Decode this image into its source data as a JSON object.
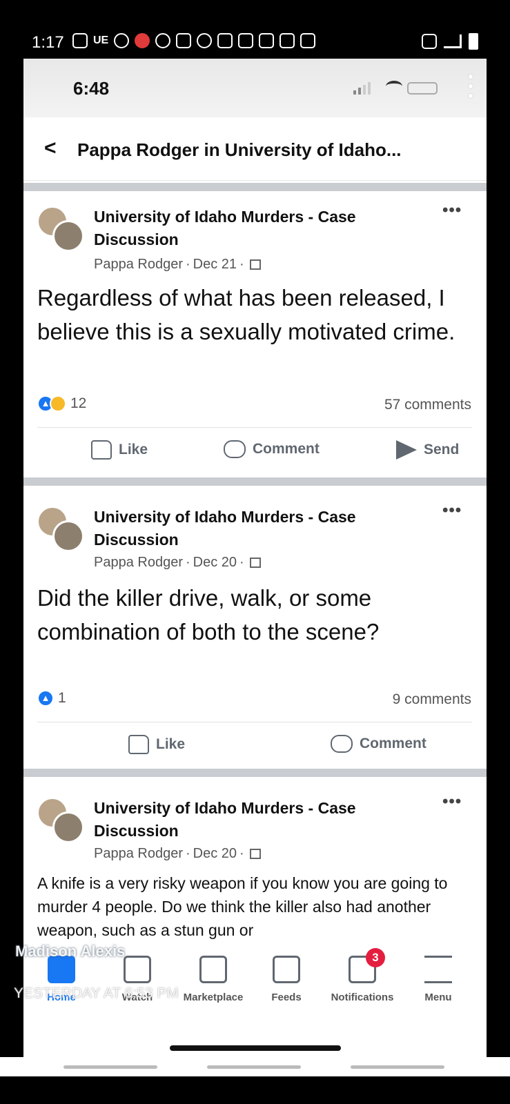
{
  "outer_status": {
    "time": "1:17",
    "carrier": "UE"
  },
  "inner_status": {
    "time": "6:48"
  },
  "header": {
    "title": "Pappa Rodger in University of Idaho..."
  },
  "posts": [
    {
      "group": "University of Idaho Murders - Case Discussion",
      "author": "Pappa Rodger",
      "date": "Dec 21",
      "body": "Regardless of what has been released, I believe this is a sexually motivated crime.",
      "reactions": "12",
      "comments": "57 comments",
      "actions": {
        "like": "Like",
        "comment": "Comment",
        "send": "Send"
      }
    },
    {
      "group": "University of Idaho Murders - Case Discussion",
      "author": "Pappa Rodger",
      "date": "Dec 20",
      "body": "Did the killer drive, walk, or some combination of both to the scene?",
      "reactions": "1",
      "comments": "9 comments",
      "actions": {
        "like": "Like",
        "comment": "Comment"
      }
    },
    {
      "group": "University of Idaho Murders - Case Discussion",
      "author": "Pappa Rodger",
      "date": "Dec 20",
      "body": "A knife is a very risky weapon if you know you are going to murder 4 people.  Do we think the killer also had another weapon, such as a stun gun or"
    }
  ],
  "tabbar": {
    "home": "Home",
    "watch": "Watch",
    "marketplace": "Marketplace",
    "feeds": "Feeds",
    "notifications": "Notifications",
    "notifications_badge": "3",
    "menu": "Menu"
  },
  "overlay": {
    "name": "Madison Alexis",
    "timestamp": "YESTERDAY AT 6:53 PM"
  },
  "icons": {
    "back": "chevron-left-icon",
    "more": "more-horizontal-icon",
    "like": "thumbs-up-icon",
    "comment": "speech-bubble-icon",
    "send": "send-icon",
    "group_privacy": "group-icon"
  },
  "colors": {
    "accent": "#1877f2",
    "badge": "#e41e3f",
    "divider": "#c9ccd1"
  }
}
